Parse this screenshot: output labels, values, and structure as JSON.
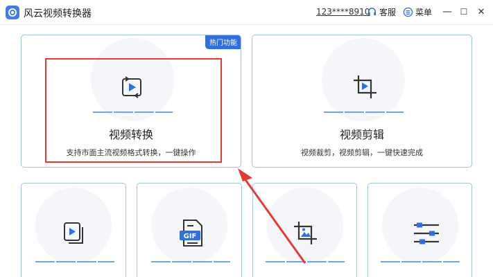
{
  "app": {
    "title": "风云视频转换器",
    "account": "123****8910",
    "service_label": "客服",
    "menu_label": "菜单",
    "minimize_glyph": "—",
    "maximize_glyph": "☐",
    "close_glyph": "✕"
  },
  "main_cards": [
    {
      "id": "video-convert",
      "title": "视频转换",
      "desc": "支持市面主流视频格式转换，一键操作",
      "badge": "热门功能",
      "icon": "convert-icon"
    },
    {
      "id": "video-edit",
      "title": "视频剪辑",
      "desc": "视频裁剪，视频剪辑，一键快速完成",
      "icon": "crop-icon"
    }
  ],
  "tool_cards": [
    {
      "id": "video-merge",
      "icon": "merge-icon"
    },
    {
      "id": "video-to-gif",
      "icon": "gif-icon",
      "icon_text": "GIF"
    },
    {
      "id": "video-crop",
      "icon": "crop-image-icon"
    },
    {
      "id": "video-adjust",
      "icon": "sliders-icon"
    }
  ],
  "colors": {
    "accent": "#2f6fe0",
    "card_border": "#9cc4ee",
    "highlight_box": "#e53935",
    "arrow": "#e53935"
  }
}
